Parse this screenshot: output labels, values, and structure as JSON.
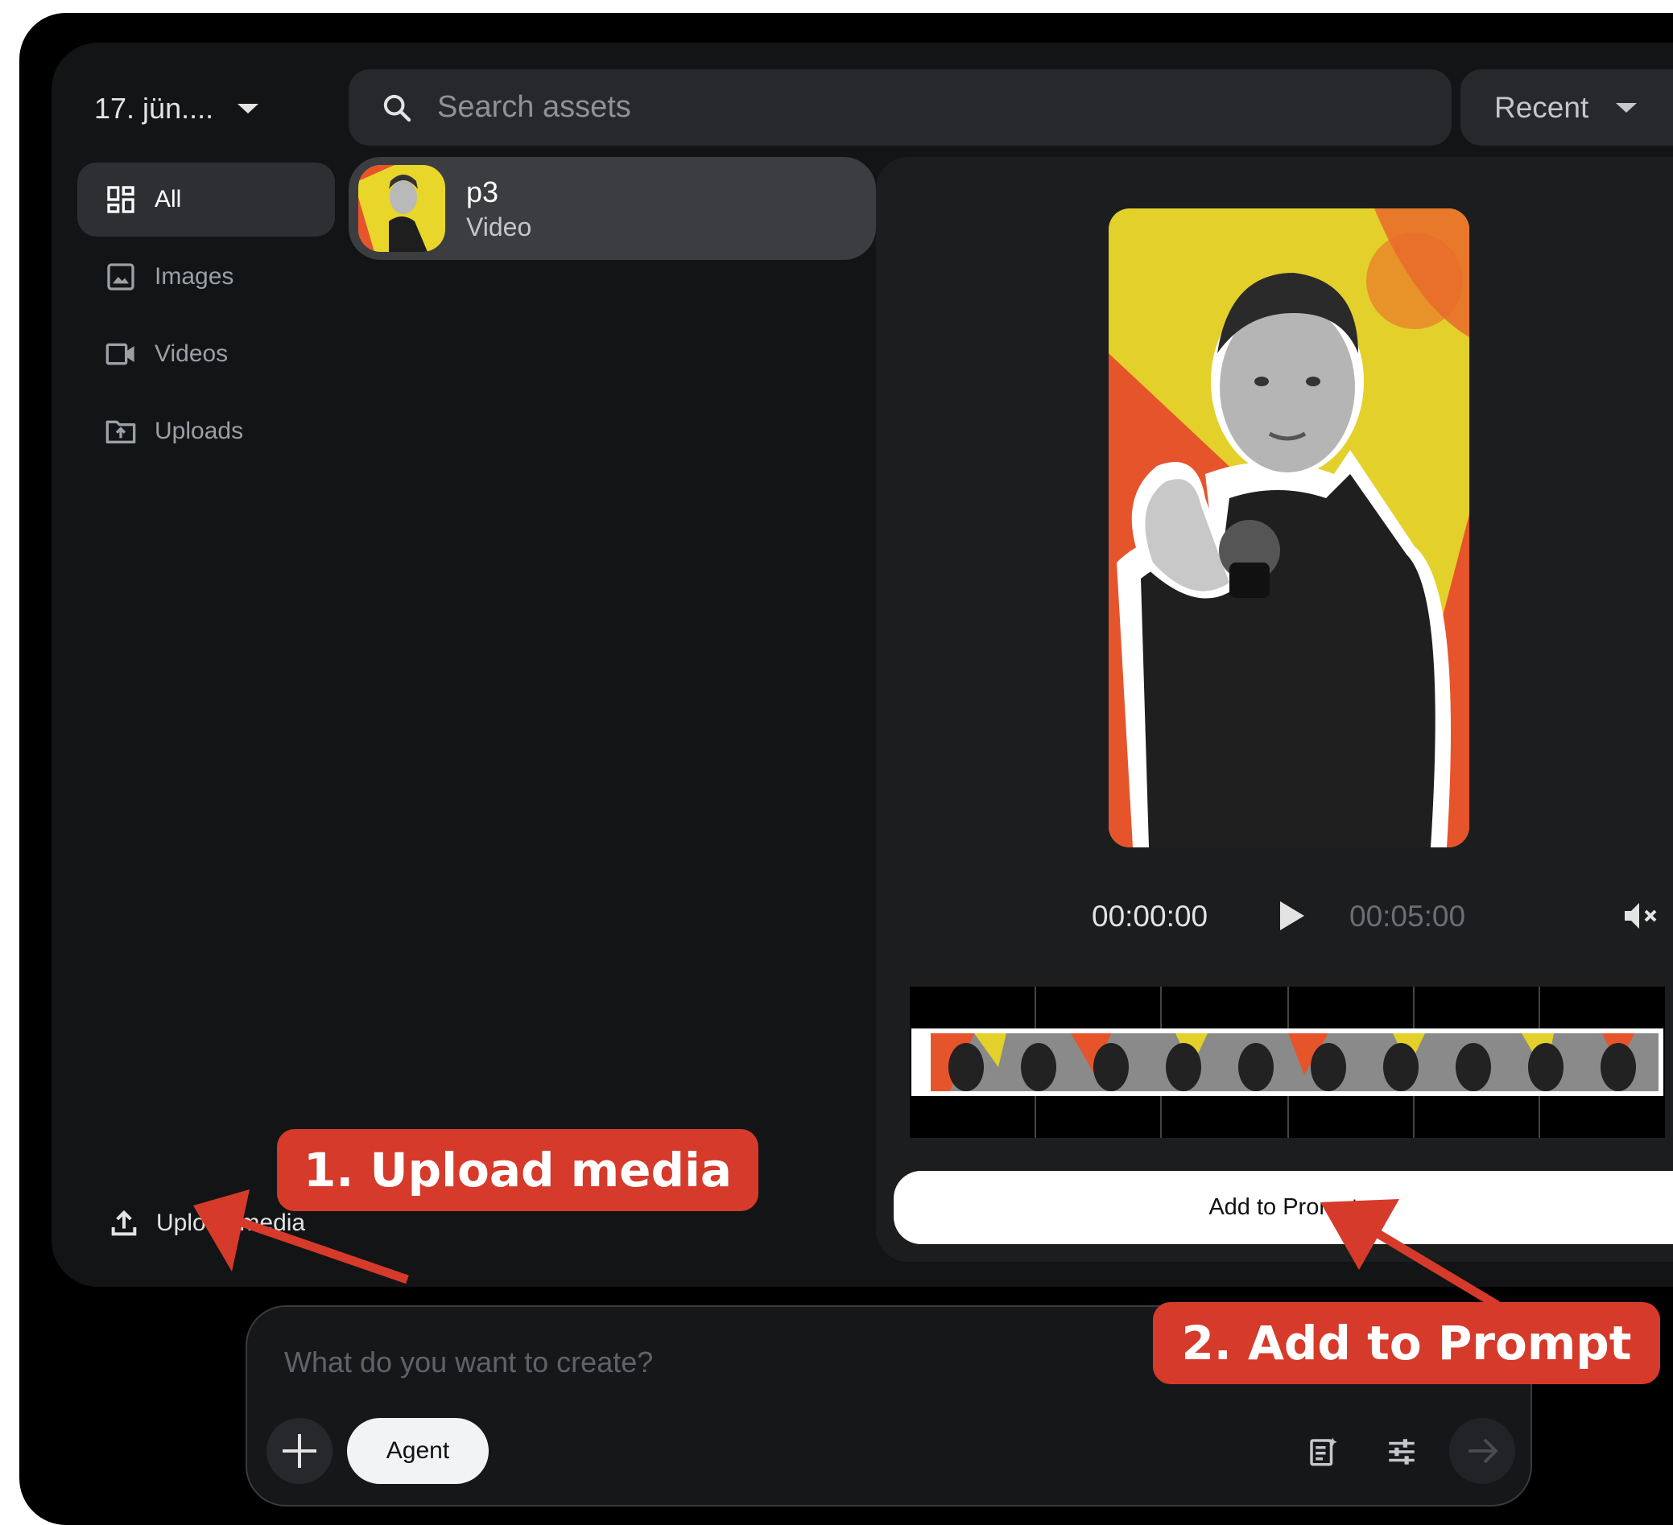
{
  "header": {
    "date_label": "17. jün....",
    "search_placeholder": "Search assets",
    "sort_label": "Recent"
  },
  "sidebar": {
    "items": [
      {
        "label": "All"
      },
      {
        "label": "Images"
      },
      {
        "label": "Videos"
      },
      {
        "label": "Uploads"
      }
    ],
    "upload_label": "Upload media"
  },
  "assets": [
    {
      "name": "p3",
      "type": "Video"
    }
  ],
  "player": {
    "current_time": "00:00:00",
    "duration": "00:05:00",
    "add_button": "Add to Prompt"
  },
  "prompt": {
    "placeholder": "What do you want to create?",
    "agent_label": "Agent"
  },
  "annotations": {
    "step1": "1. Upload media",
    "step2": "2. Add to Prompt",
    "color": "#d63a2a"
  },
  "colors": {
    "background": "#131416",
    "panel": "#1c1d1f",
    "accent_yellow": "#e8d62a",
    "accent_orange": "#e6542c"
  }
}
